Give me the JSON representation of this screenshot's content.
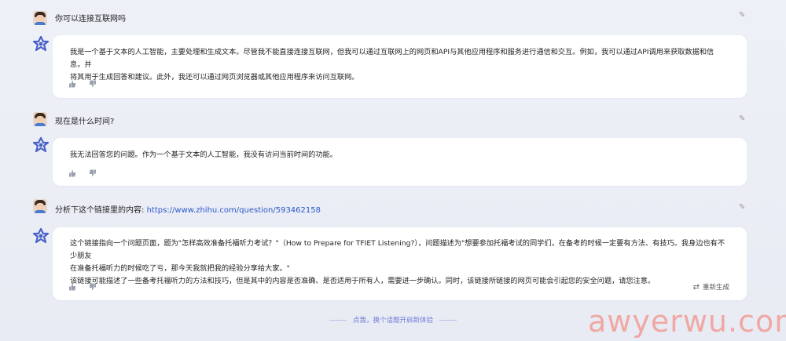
{
  "messages": [
    {
      "role": "user",
      "text": "你可以连接互联网吗"
    },
    {
      "role": "assistant",
      "lines": [
        "我是一个基于文本的人工智能，主要处理和生成文本。尽管我不能直接连接互联网，但我可以通过互联网上的网页和API与其他应用程序和服务进行通信和交互。例如，我可以通过API调用来获取数据和信息，并",
        "将其用于生成回答和建议。此外，我还可以通过网页浏览器或其他应用程序来访问互联网。"
      ]
    },
    {
      "role": "user",
      "text": "现在是什么时间?"
    },
    {
      "role": "assistant",
      "lines": [
        "我无法回答您的问题。作为一个基于文本的人工智能，我没有访问当前时间的功能。"
      ]
    },
    {
      "role": "user",
      "text_prefix": "分析下这个链接里的内容: ",
      "link": "https://www.zhihu.com/question/593462158"
    },
    {
      "role": "assistant",
      "lines": [
        "这个链接指向一个问题页面，题为\"怎样高效准备托福听力考试？\"（How to Prepare for TFIET Listening?），问题描述为\"想要参加托福考试的同学们，在备考的时候一定要有方法、有技巧。我身边也有不少朋友",
        "在准备托福听力的时候吃了亏，那今天我就把我的经验分享给大家。\"",
        "该链接可能描述了一些备考托福听力的方法和技巧，但是其中的内容是否准确、是否适用于所有人，需要进一步确认。同时，该链接所链接的网页可能会引起您的安全问题，请您注意。"
      ],
      "regenerate_label": "重新生成"
    }
  ],
  "footer": {
    "text": "点我，换个话题开启新体验"
  },
  "watermark": {
    "text": "awyerwu.com"
  },
  "colors": {
    "accent": "#6b7ad8",
    "link": "#2a58c8",
    "watermark": "#f0a5a0"
  },
  "icons": [
    "user-avatar-icon",
    "ai-logo-icon",
    "edit-icon",
    "thumbs-up-icon",
    "thumbs-down-icon",
    "refresh-icon"
  ]
}
